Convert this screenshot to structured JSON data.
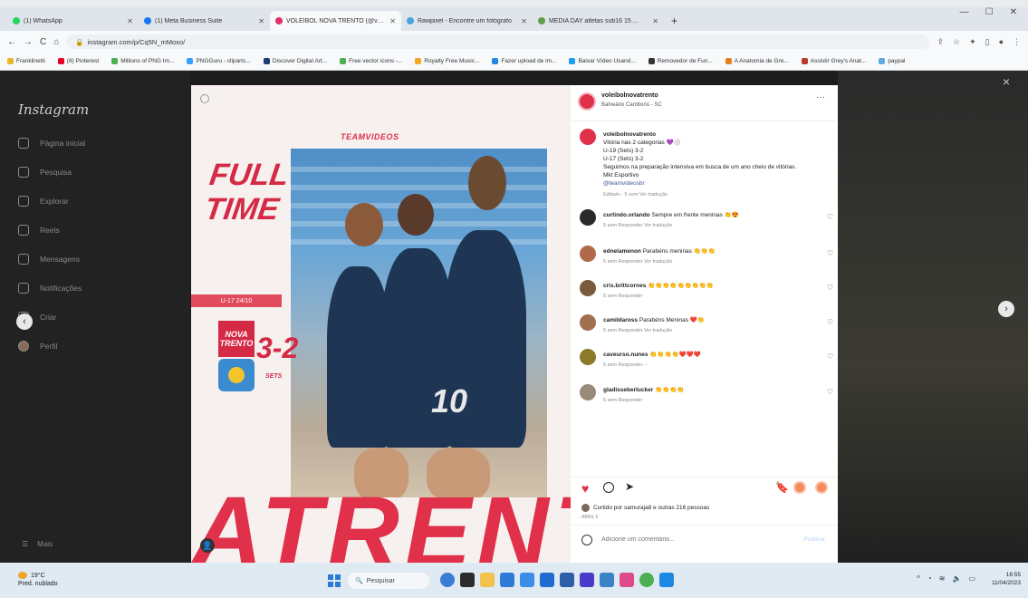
{
  "browser": {
    "tabs": [
      {
        "title": "(1) WhatsApp",
        "color": "#25d366",
        "active": false
      },
      {
        "title": "(1) Meta Business Suite",
        "color": "#1877f2",
        "active": false
      },
      {
        "title": "VOLEIBOL NOVA TRENTO (@vol...",
        "color": "#e1306c",
        "active": true
      },
      {
        "title": "Rawpixel - Encontre um fotógrafo",
        "color": "#4aa3df",
        "active": false
      },
      {
        "title": "MEDIA DAY atletas sub16 15 ...",
        "color": "#5f9e4a",
        "active": false
      }
    ],
    "new_tab": "+",
    "url": "instagram.com/p/Cq5N_mMoxo/",
    "nav": {
      "back": "←",
      "forward": "→",
      "reload": "C",
      "home": "⌂"
    },
    "bookmarks": [
      "Franklinetti",
      "(8) Pinterest",
      "Millions of PNG Im...",
      "PNGGuru - cliparts...",
      "Discover Digital Art...",
      "Free vector icons -...",
      "Royalty Free Music...",
      "Fazer upload de im...",
      "Baixar Vídeo Usand...",
      "Removedor de Fun...",
      "A Anatomia de Gre...",
      "Assistir Grey's Anat...",
      "paypal"
    ]
  },
  "instagram": {
    "logo": "Instagram",
    "nav": [
      {
        "label": "Página inicial",
        "icon": "home-icon"
      },
      {
        "label": "Pesquisa",
        "icon": "search-icon"
      },
      {
        "label": "Explorar",
        "icon": "compass-icon"
      },
      {
        "label": "Reels",
        "icon": "reels-icon"
      },
      {
        "label": "Mensagens",
        "icon": "messenger-icon"
      },
      {
        "label": "Notificações",
        "icon": "heart-icon"
      },
      {
        "label": "Criar",
        "icon": "plus-icon"
      },
      {
        "label": "Perfil",
        "icon": "profile-icon"
      }
    ],
    "more": "Mais",
    "close": "×",
    "prev": "‹",
    "next": "›"
  },
  "post_image": {
    "brand": "TEAMVIDEOS",
    "full_time": "FULL TIME",
    "date_band": "U-17 24/10",
    "team1": "NOVA TRENTO",
    "score": "3-2",
    "sets": "SETS",
    "jersey_number": "10",
    "big_text": "ATRENT"
  },
  "post": {
    "username": "voleibolnovatrento",
    "location": "Balneário Camboriú - SC",
    "more": "···",
    "caption": {
      "user": "voleibolnovatrento",
      "lines": [
        "Vitória nas 2 categorias 💜⚪",
        "U-19 (Sets) 3-2",
        "U-17 (Sets) 3-2",
        "Seguimos na preparação intensiva em busca de um ano cheio de vitórias.",
        "Mkt Esportivo"
      ],
      "mention": "@teamvideosbr",
      "meta": "Editado · 5 sem   Ver tradução"
    },
    "comments": [
      {
        "user": "curtindo.orlando",
        "text": "Sempre em frente meninas 👏😍",
        "meta": "5 sem   Responder   Ver tradução",
        "color": "#2a2a2a"
      },
      {
        "user": "ednelamenon",
        "text": "Parabéns meninas 👏👏👏",
        "meta": "5 sem   Responder   Ver tradução",
        "color": "#b06a4a"
      },
      {
        "user": "cris.brittcornes",
        "text": "👏👏👏👏👏👏👏👏👏",
        "meta": "5 sem   Responder",
        "color": "#7a5a3a"
      },
      {
        "user": "camildaross",
        "text": "Parabéns Meninas ❤️👏",
        "meta": "5 sem   Responder   Ver tradução",
        "color": "#a07050"
      },
      {
        "user": "caveurso.nunes",
        "text": "👏👏👏👏❤️❤️❤️",
        "meta": "5 sem   Responder   ···",
        "color": "#8a7a2a"
      },
      {
        "user": "gladisseberlucker",
        "text": "👏👏👏👏",
        "meta": "5 sem   Responder",
        "color": "#9a8a7a"
      }
    ],
    "likes_text": "Curtido por samuraja8 e outras 216 pessoas",
    "date": "ABRIL 5",
    "comment_placeholder": "Adicione um comentário...",
    "publish": "Publicar"
  },
  "taskbar": {
    "temp": "19°C",
    "weather": "Pred. nublado",
    "search": "Pesquisar",
    "time": "16:55",
    "date": "11/04/2023"
  }
}
